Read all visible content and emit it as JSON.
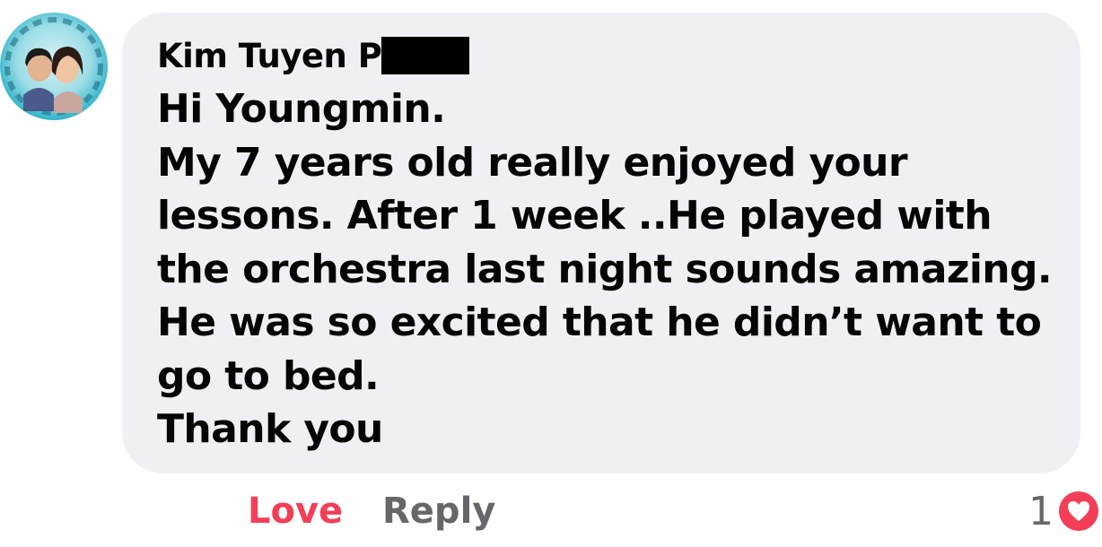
{
  "comment": {
    "author": "Kim Tuyen P",
    "lines": [
      "Hi Youngmin.",
      "My 7 years old really enjoyed your",
      "lessons. After 1 week ..He played with",
      "the orchestra last night sounds amazing.",
      "He was so excited that he didn’t want to",
      "go to bed.",
      "Thank you"
    ]
  },
  "actions": {
    "love_label": "Love",
    "reply_label": "Reply"
  },
  "reactions": {
    "count": "1",
    "icon": "heart-icon"
  },
  "colors": {
    "bubble": "#eff0f4",
    "love": "#f33e58",
    "secondary_text": "#65676b",
    "text": "#050505"
  }
}
